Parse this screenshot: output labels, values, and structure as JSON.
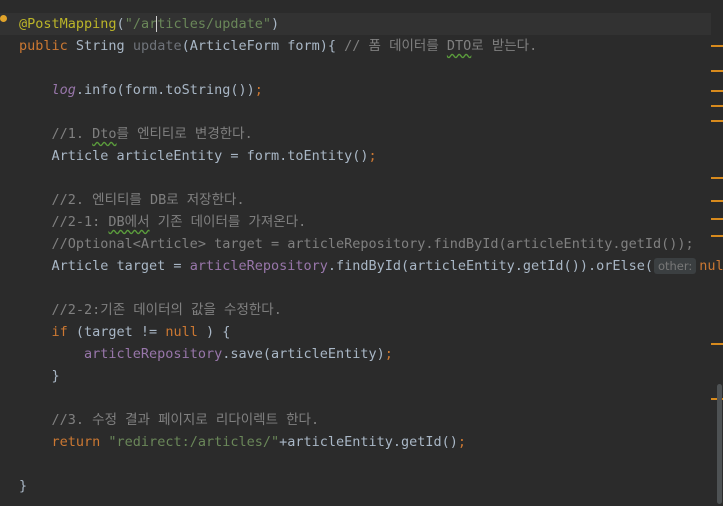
{
  "colors": {
    "background": "#2b2b2b",
    "current_line": "#323232",
    "plain": "#a9b7c6",
    "keyword": "#cc7832",
    "string": "#6a8759",
    "comment": "#808080",
    "annotation": "#bbb529",
    "field": "#9876aa",
    "method": "#ffc66d",
    "unused": "#6f737a",
    "marker": "#d78a1d"
  },
  "gutter": {
    "icon": "bulb-icon"
  },
  "code": [
    [
      [
        "annotation",
        "@PostMapping"
      ],
      [
        "plain",
        "("
      ],
      [
        "string",
        "\"/articles/update\""
      ],
      [
        "plain",
        ")"
      ]
    ],
    [
      [
        "keyword",
        "public "
      ],
      [
        "plain",
        "String "
      ],
      [
        "unused",
        "update"
      ],
      [
        "plain",
        "(ArticleForm form){ "
      ],
      [
        "comment",
        "// 폼 데이터를 "
      ],
      [
        "comment_squig",
        "DTO"
      ],
      [
        "comment",
        "로 받는다."
      ]
    ],
    [],
    [
      [
        "plain",
        "    "
      ],
      [
        "field_italic",
        "log"
      ],
      [
        "plain",
        ".info(form.toString())"
      ],
      [
        "keyword",
        ";"
      ]
    ],
    [],
    [
      [
        "plain",
        "    "
      ],
      [
        "comment",
        "//1. "
      ],
      [
        "comment_squig",
        "Dto"
      ],
      [
        "comment",
        "를 엔티티로 변경한다."
      ]
    ],
    [
      [
        "plain",
        "    Article articleEntity = form.toEntity()"
      ],
      [
        "keyword",
        ";"
      ]
    ],
    [],
    [
      [
        "plain",
        "    "
      ],
      [
        "comment",
        "//2. 엔티티를 DB로 저장한다."
      ]
    ],
    [
      [
        "plain",
        "    "
      ],
      [
        "comment",
        "//2-1: "
      ],
      [
        "comment_squig",
        "DB에서"
      ],
      [
        "comment",
        " 기존 데이터를 가져온다."
      ]
    ],
    [
      [
        "plain",
        "    "
      ],
      [
        "comment",
        "//Optional<Article> target = articleRepository.findById(articleEntity.getId());"
      ]
    ],
    [
      [
        "plain",
        "    Article target = "
      ],
      [
        "field",
        "articleRepository"
      ],
      [
        "plain",
        ".findById(articleEntity.getId()).orElse("
      ],
      [
        "hint",
        "other:"
      ],
      [
        "keyword",
        "null"
      ],
      [
        "plain",
        ")"
      ],
      [
        "keyword",
        ";"
      ]
    ],
    [],
    [
      [
        "plain",
        "    "
      ],
      [
        "comment",
        "//2-2:기존 데이터의 값을 수정한다."
      ]
    ],
    [
      [
        "plain",
        "    "
      ],
      [
        "keyword",
        "if "
      ],
      [
        "plain",
        "(target != "
      ],
      [
        "keyword",
        "null "
      ],
      [
        "plain",
        ") {"
      ]
    ],
    [
      [
        "plain",
        "        "
      ],
      [
        "field",
        "articleRepository"
      ],
      [
        "plain",
        ".save(articleEntity)"
      ],
      [
        "keyword",
        ";"
      ]
    ],
    [
      [
        "plain",
        "    }"
      ]
    ],
    [],
    [
      [
        "plain",
        "    "
      ],
      [
        "comment",
        "//3. 수정 결과 페이지로 리다이렉트 한다."
      ]
    ],
    [
      [
        "plain",
        "    "
      ],
      [
        "keyword",
        "return "
      ],
      [
        "string",
        "\"redirect:/articles/\""
      ],
      [
        "plain",
        "+articleEntity.getId()"
      ],
      [
        "keyword",
        ";"
      ]
    ],
    [],
    [
      [
        "plain",
        "}"
      ]
    ]
  ]
}
